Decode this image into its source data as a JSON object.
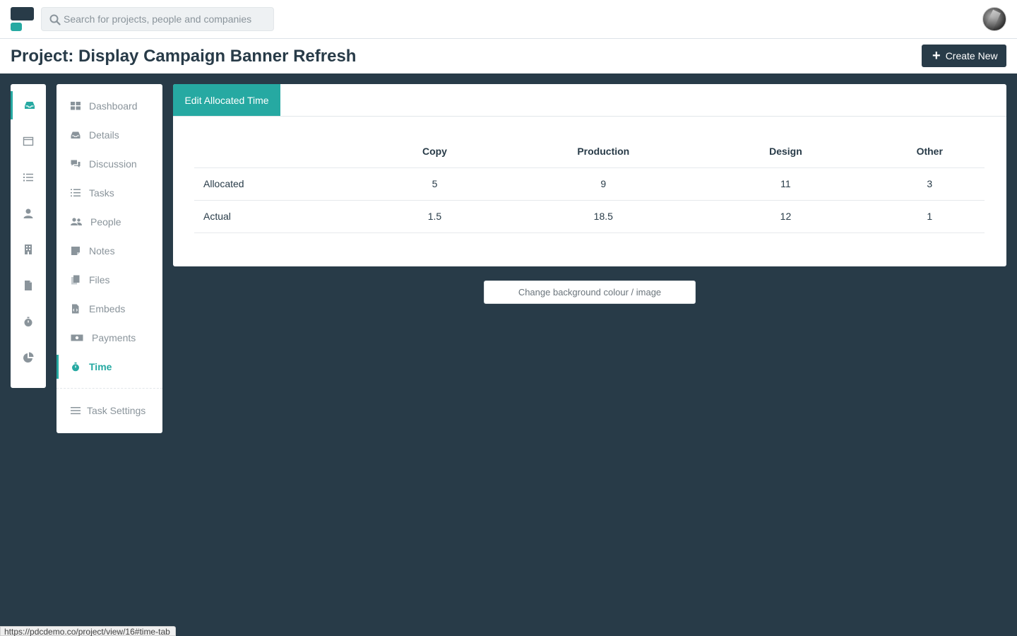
{
  "header": {
    "search_placeholder": "Search for projects, people and companies",
    "search_icon": "search-icon",
    "avatar": "user-avatar"
  },
  "title_bar": {
    "title": "Project: Display Campaign Banner Refresh",
    "create_button": "Create New",
    "create_icon": "plus-icon"
  },
  "rail": {
    "items": [
      {
        "icon": "inbox-icon",
        "active": true
      },
      {
        "icon": "calendar-icon",
        "active": false
      },
      {
        "icon": "list-icon",
        "active": false
      },
      {
        "icon": "user-icon",
        "active": false
      },
      {
        "icon": "building-icon",
        "active": false
      },
      {
        "icon": "file-icon",
        "active": false
      },
      {
        "icon": "stopwatch-icon",
        "active": false
      },
      {
        "icon": "pie-chart-icon",
        "active": false
      }
    ]
  },
  "subnav": {
    "items": [
      {
        "label": "Dashboard",
        "icon": "dashboard-icon"
      },
      {
        "label": "Details",
        "icon": "inbox-icon"
      },
      {
        "label": "Discussion",
        "icon": "comments-icon"
      },
      {
        "label": "Tasks",
        "icon": "tasks-icon"
      },
      {
        "label": "People",
        "icon": "people-icon"
      },
      {
        "label": "Notes",
        "icon": "note-icon"
      },
      {
        "label": "Files",
        "icon": "files-icon"
      },
      {
        "label": "Embeds",
        "icon": "code-file-icon"
      },
      {
        "label": "Payments",
        "icon": "money-icon"
      },
      {
        "label": "Time",
        "icon": "stopwatch-icon"
      }
    ],
    "active": "Time",
    "settings_label": "Task Settings",
    "settings_icon": "menu-icon"
  },
  "panel": {
    "tab_label": "Edit Allocated Time",
    "table": {
      "headers": [
        "",
        "Copy",
        "Production",
        "Design",
        "Other"
      ],
      "rows": [
        [
          "Allocated",
          "5",
          "9",
          "11",
          "3"
        ],
        [
          "Actual",
          "1.5",
          "18.5",
          "12",
          "1"
        ]
      ]
    }
  },
  "background_button": "Change background colour / image",
  "status_url": "https://pdcdemo.co/project/view/16#time-tab",
  "colors": {
    "accent": "#26a9a2",
    "dark": "#283b48",
    "muted": "#8a949b"
  }
}
